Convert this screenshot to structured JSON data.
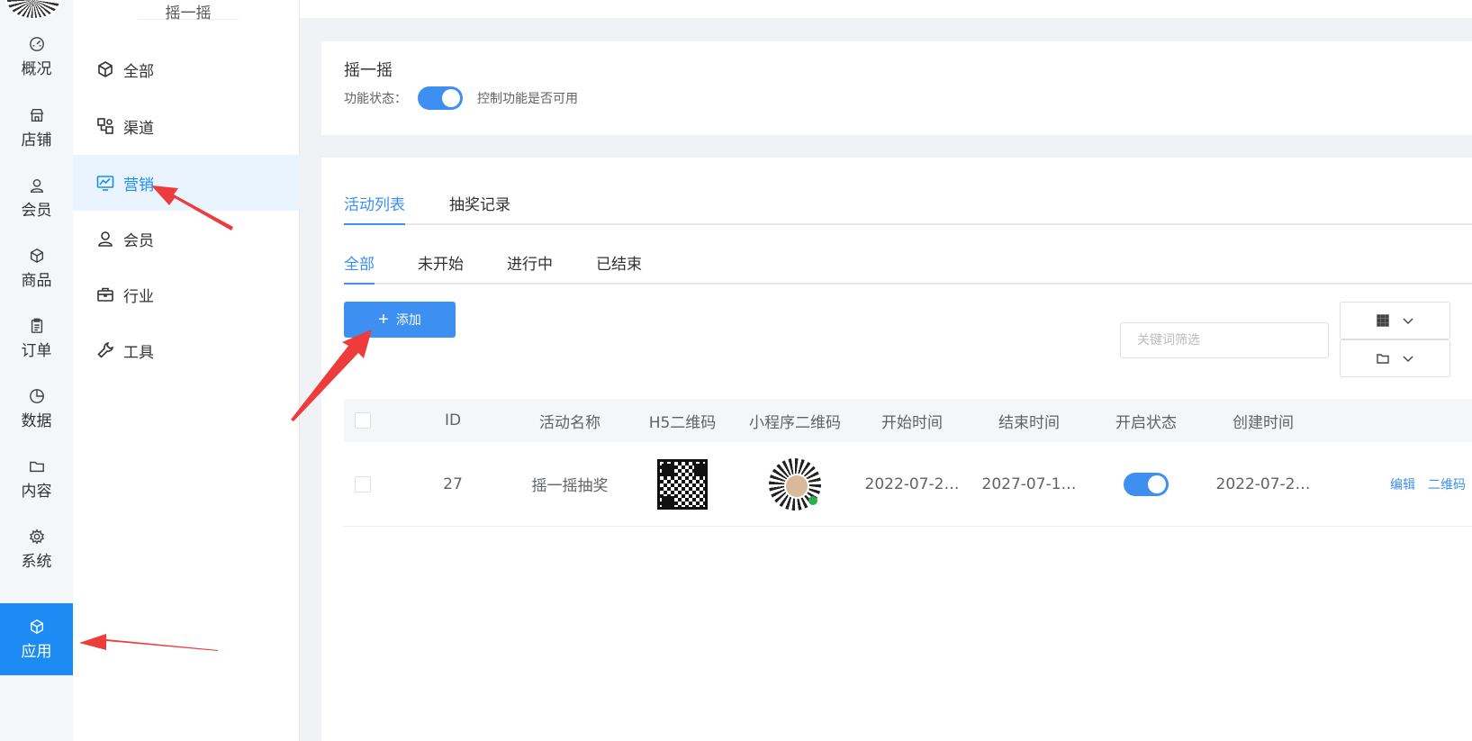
{
  "rail": {
    "items": [
      {
        "label": "概况",
        "icon": "dashboard-icon"
      },
      {
        "label": "店铺",
        "icon": "store-icon"
      },
      {
        "label": "会员",
        "icon": "user-icon"
      },
      {
        "label": "商品",
        "icon": "box-icon"
      },
      {
        "label": "订单",
        "icon": "clipboard-icon"
      },
      {
        "label": "数据",
        "icon": "pie-icon"
      },
      {
        "label": "内容",
        "icon": "folder-icon"
      },
      {
        "label": "系统",
        "icon": "gear-icon"
      },
      {
        "label": "应用",
        "icon": "cube-icon"
      }
    ],
    "active_index": 8
  },
  "submenu": {
    "title": "摇一摇",
    "items": [
      {
        "label": "全部",
        "icon": "cube-icon"
      },
      {
        "label": "渠道",
        "icon": "channel-icon"
      },
      {
        "label": "营销",
        "icon": "chart-screen-icon"
      },
      {
        "label": "会员",
        "icon": "user-icon"
      },
      {
        "label": "行业",
        "icon": "briefcase-icon"
      },
      {
        "label": "工具",
        "icon": "wrench-icon"
      }
    ],
    "active_index": 2
  },
  "panel1": {
    "title": "摇一摇",
    "status_label": "功能状态：",
    "switch_on": true,
    "status_hint": "控制功能是否可用"
  },
  "tabs_main": [
    "活动列表",
    "抽奖记录"
  ],
  "tabs_filter": [
    "全部",
    "未开始",
    "进行中",
    "已结束"
  ],
  "toolbar": {
    "add_label": "添加",
    "keyword_placeholder": "关键词筛选"
  },
  "table": {
    "headers": [
      "ID",
      "活动名称",
      "H5二维码",
      "小程序二维码",
      "开始时间",
      "结束时间",
      "开启状态",
      "创建时间"
    ],
    "rows": [
      {
        "id": "27",
        "name": "摇一摇抽奖",
        "start": "2022-07-2…",
        "end": "2027-07-1…",
        "enabled": true,
        "created": "2022-07-2…",
        "ops": [
          "编辑",
          "二维码"
        ]
      }
    ]
  },
  "colors": {
    "accent": "#3d8ff2",
    "rail_active": "#1c8cf4",
    "annotation_arrow": "#ee3b3b"
  }
}
